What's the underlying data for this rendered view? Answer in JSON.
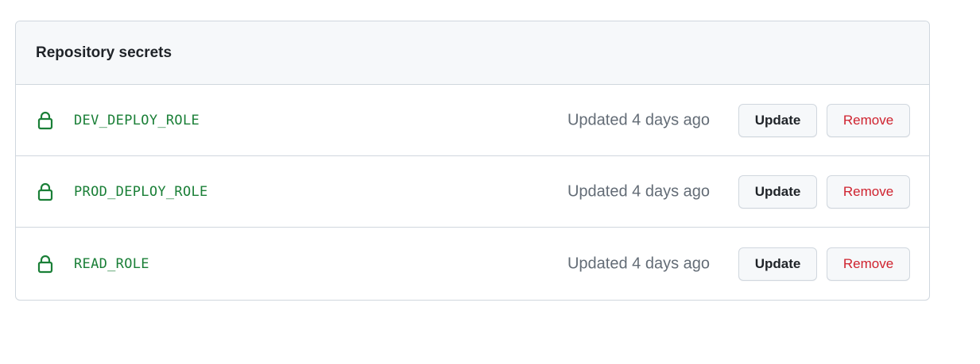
{
  "section": {
    "title": "Repository secrets"
  },
  "secrets": [
    {
      "name": "DEV_DEPLOY_ROLE",
      "updated": "Updated 4 days ago",
      "update_label": "Update",
      "remove_label": "Remove"
    },
    {
      "name": "PROD_DEPLOY_ROLE",
      "updated": "Updated 4 days ago",
      "update_label": "Update",
      "remove_label": "Remove"
    },
    {
      "name": "READ_ROLE",
      "updated": "Updated 4 days ago",
      "update_label": "Update",
      "remove_label": "Remove"
    }
  ],
  "icons": {
    "secret": "lock-icon"
  },
  "colors": {
    "secret_name": "#1a7f37",
    "lock_icon": "#1a7f37",
    "remove_text": "#cf222e",
    "muted_text": "#636c76",
    "border": "#d0d7de",
    "header_bg": "#f6f8fa"
  }
}
